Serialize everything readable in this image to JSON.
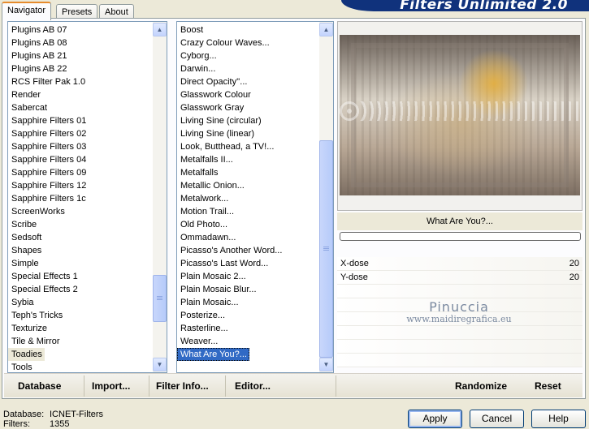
{
  "tabs": [
    "Navigator",
    "Presets",
    "About"
  ],
  "banner_title": "Filters Unlimited 2.0",
  "categories": [
    "Plugins AB 07",
    "Plugins AB 08",
    "Plugins AB 21",
    "Plugins AB 22",
    "RCS Filter Pak 1.0",
    "Render",
    "Sabercat",
    "Sapphire Filters 01",
    "Sapphire Filters 02",
    "Sapphire Filters 03",
    "Sapphire Filters 04",
    "Sapphire Filters 09",
    "Sapphire Filters 12",
    "Sapphire Filters 1c",
    "ScreenWorks",
    "Scribe",
    "Sedsoft",
    "Shapes",
    "Simple",
    "Special Effects 1",
    "Special Effects 2",
    "Sybia",
    "Teph's Tricks",
    "Texturize",
    "Tile & Mirror",
    "Toadies",
    "Tools"
  ],
  "selected_category": "Toadies",
  "filters": [
    "Boost",
    "Crazy Colour Waves...",
    "Cyborg...",
    "Darwin...",
    "Direct Opacity''...",
    "Glasswork Colour",
    "Glasswork Gray",
    "Living Sine (circular)",
    "Living Sine (linear)",
    "Look, Butthead, a TV!...",
    "Metalfalls II...",
    "Metalfalls",
    "Metallic Onion...",
    "Metalwork...",
    "Motion Trail...",
    "Old Photo...",
    "Ommadawn...",
    "Picasso's Another Word...",
    "Picasso's Last Word...",
    "Plain Mosaic 2...",
    "Plain Mosaic Blur...",
    "Plain Mosaic...",
    "Posterize...",
    "Rasterline...",
    "Weaver...",
    "What Are You?..."
  ],
  "selected_filter": "What Are You?...",
  "filter_name": "What Are You?...",
  "params": [
    {
      "label": "X-dose",
      "value": "20"
    },
    {
      "label": "Y-dose",
      "value": "20"
    }
  ],
  "watermark": {
    "line1": "Pinuccia",
    "line2": "www.maidiregrafica.eu"
  },
  "toolbar": {
    "database": "Database",
    "import": "Import...",
    "filter_info": "Filter Info...",
    "editor": "Editor...",
    "randomize": "Randomize",
    "reset": "Reset"
  },
  "status": {
    "database_label": "Database:",
    "database_value": "ICNET-Filters",
    "filters_label": "Filters:",
    "filters_value": "1355"
  },
  "buttons": {
    "apply": "Apply",
    "cancel": "Cancel",
    "help": "Help"
  }
}
